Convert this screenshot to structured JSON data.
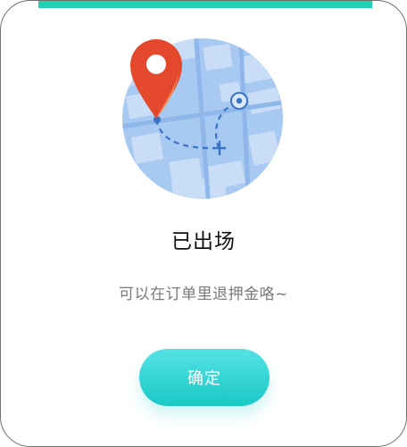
{
  "dialog": {
    "title": "已出场",
    "message": "可以在订单里退押金咯~",
    "confirm_label": "确定"
  },
  "illustration": {
    "icons": [
      "map-circle-icon",
      "location-pin-icon",
      "target-marker-icon",
      "route-end-cross-icon"
    ]
  },
  "colors": {
    "accent": "#1fd1b5",
    "button_top": "#55e2e4",
    "button_bottom": "#19c9c6",
    "pin": "#e4492d",
    "map_base": "#a7c9f2",
    "route": "#3a73c6"
  }
}
